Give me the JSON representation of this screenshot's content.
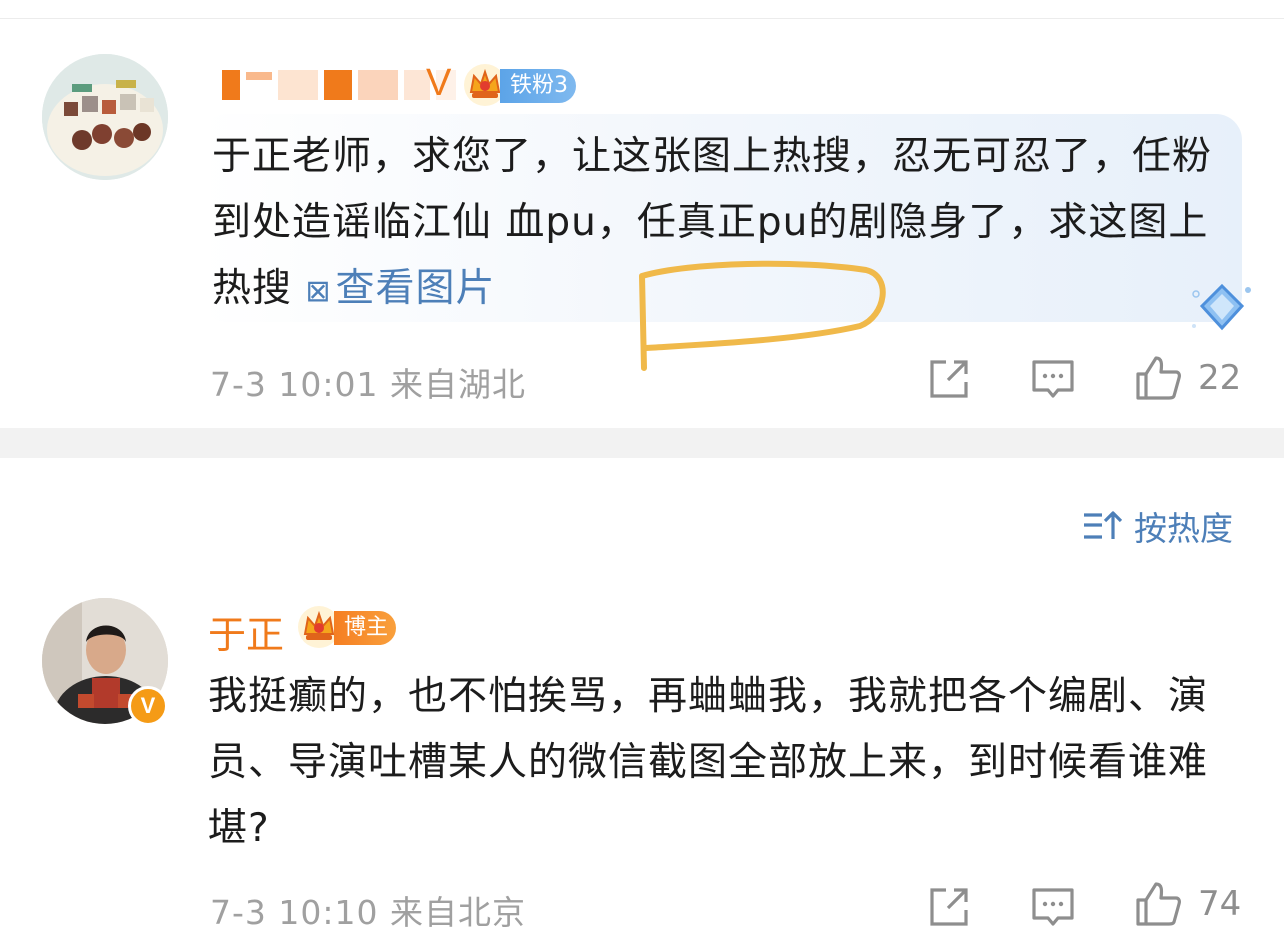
{
  "comment1": {
    "badge": "铁粉3",
    "text": "于正老师，求您了，让这张图上热搜，忍无可忍了，任粉到处造谣临江仙 血pu，任真正pu的剧隐身了，求这图上热搜 ",
    "view_image": "查看图片",
    "meta": "7-3 10:01 来自湖北",
    "likes": "22"
  },
  "sort_label": "按热度",
  "comment2": {
    "name": "于正",
    "badge": "博主",
    "text": "我挺癫的，也不怕挨骂，再蛐蛐我，我就把各个编剧、演员、导演吐槽某人的微信截图全部放上来，到时候看谁难堪?",
    "meta": "7-3 10:10 来自北京",
    "likes": "74"
  },
  "colors": {
    "username_orange": "#f07a1b",
    "link_blue": "#4d7fb8",
    "fan_badge": "#5ca4e8",
    "host_badge": "#f57e22"
  },
  "icons": [
    "repost-icon",
    "comment-icon",
    "like-icon",
    "sort-icon",
    "crown-icon",
    "view-image-icon",
    "diamond-icon"
  ]
}
